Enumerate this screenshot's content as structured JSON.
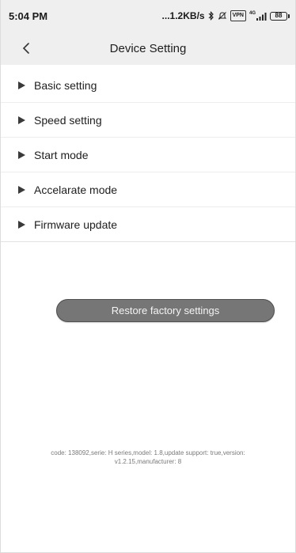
{
  "status_bar": {
    "time": "5:04 PM",
    "network_speed": "...1.2KB/s",
    "vpn_label": "VPN",
    "signal_label": "4G",
    "battery_level": "88",
    "icons": [
      "bluetooth-icon",
      "mute-icon",
      "vpn-icon",
      "signal-icon",
      "battery-icon"
    ]
  },
  "header": {
    "title": "Device Setting",
    "back_icon": "chevron-left-icon"
  },
  "menu": {
    "items": [
      {
        "label": "Basic setting"
      },
      {
        "label": "Speed setting"
      },
      {
        "label": "Start mode"
      },
      {
        "label": "Accelarate mode"
      },
      {
        "label": "Firmware update"
      }
    ],
    "item_icon": "triangle-right-icon"
  },
  "restore": {
    "label": "Restore factory settings"
  },
  "device_info": {
    "line1": "code: 138092,serie: H series,model: 1.8,update support: true,version:",
    "line2": "v1.2.15,manufacturer: 8"
  },
  "colors": {
    "bar_background": "#efefef",
    "button_background": "#767676",
    "button_text": "#f4f4f4",
    "info_text": "#7a7a7a"
  }
}
